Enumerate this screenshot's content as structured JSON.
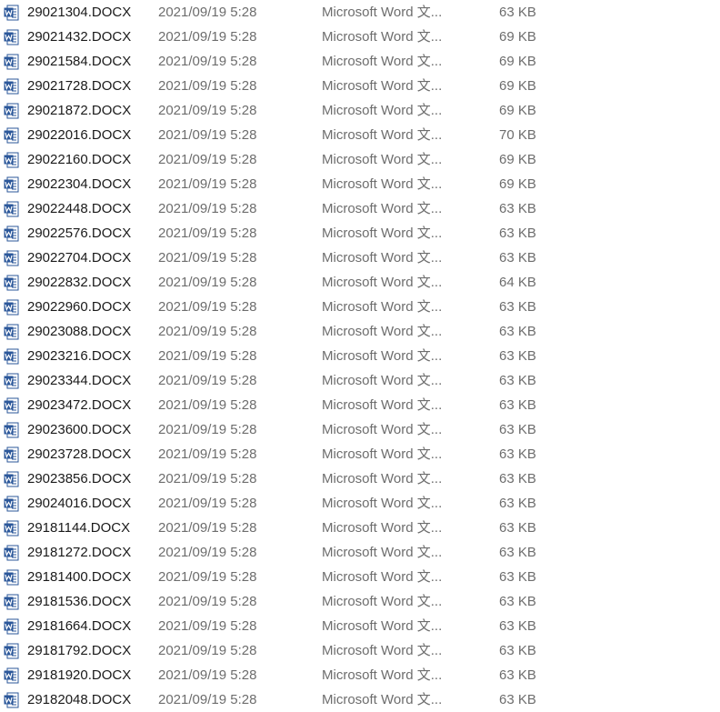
{
  "file_list": {
    "rows": [
      {
        "name": "29021304.DOCX",
        "modified": "2021/09/19 5:28",
        "type": "Microsoft Word 文...",
        "size": "63 KB"
      },
      {
        "name": "29021432.DOCX",
        "modified": "2021/09/19 5:28",
        "type": "Microsoft Word 文...",
        "size": "69 KB"
      },
      {
        "name": "29021584.DOCX",
        "modified": "2021/09/19 5:28",
        "type": "Microsoft Word 文...",
        "size": "69 KB"
      },
      {
        "name": "29021728.DOCX",
        "modified": "2021/09/19 5:28",
        "type": "Microsoft Word 文...",
        "size": "69 KB"
      },
      {
        "name": "29021872.DOCX",
        "modified": "2021/09/19 5:28",
        "type": "Microsoft Word 文...",
        "size": "69 KB"
      },
      {
        "name": "29022016.DOCX",
        "modified": "2021/09/19 5:28",
        "type": "Microsoft Word 文...",
        "size": "70 KB"
      },
      {
        "name": "29022160.DOCX",
        "modified": "2021/09/19 5:28",
        "type": "Microsoft Word 文...",
        "size": "69 KB"
      },
      {
        "name": "29022304.DOCX",
        "modified": "2021/09/19 5:28",
        "type": "Microsoft Word 文...",
        "size": "69 KB"
      },
      {
        "name": "29022448.DOCX",
        "modified": "2021/09/19 5:28",
        "type": "Microsoft Word 文...",
        "size": "63 KB"
      },
      {
        "name": "29022576.DOCX",
        "modified": "2021/09/19 5:28",
        "type": "Microsoft Word 文...",
        "size": "63 KB"
      },
      {
        "name": "29022704.DOCX",
        "modified": "2021/09/19 5:28",
        "type": "Microsoft Word 文...",
        "size": "63 KB"
      },
      {
        "name": "29022832.DOCX",
        "modified": "2021/09/19 5:28",
        "type": "Microsoft Word 文...",
        "size": "64 KB"
      },
      {
        "name": "29022960.DOCX",
        "modified": "2021/09/19 5:28",
        "type": "Microsoft Word 文...",
        "size": "63 KB"
      },
      {
        "name": "29023088.DOCX",
        "modified": "2021/09/19 5:28",
        "type": "Microsoft Word 文...",
        "size": "63 KB"
      },
      {
        "name": "29023216.DOCX",
        "modified": "2021/09/19 5:28",
        "type": "Microsoft Word 文...",
        "size": "63 KB"
      },
      {
        "name": "29023344.DOCX",
        "modified": "2021/09/19 5:28",
        "type": "Microsoft Word 文...",
        "size": "63 KB"
      },
      {
        "name": "29023472.DOCX",
        "modified": "2021/09/19 5:28",
        "type": "Microsoft Word 文...",
        "size": "63 KB"
      },
      {
        "name": "29023600.DOCX",
        "modified": "2021/09/19 5:28",
        "type": "Microsoft Word 文...",
        "size": "63 KB"
      },
      {
        "name": "29023728.DOCX",
        "modified": "2021/09/19 5:28",
        "type": "Microsoft Word 文...",
        "size": "63 KB"
      },
      {
        "name": "29023856.DOCX",
        "modified": "2021/09/19 5:28",
        "type": "Microsoft Word 文...",
        "size": "63 KB"
      },
      {
        "name": "29024016.DOCX",
        "modified": "2021/09/19 5:28",
        "type": "Microsoft Word 文...",
        "size": "63 KB"
      },
      {
        "name": "29181144.DOCX",
        "modified": "2021/09/19 5:28",
        "type": "Microsoft Word 文...",
        "size": "63 KB"
      },
      {
        "name": "29181272.DOCX",
        "modified": "2021/09/19 5:28",
        "type": "Microsoft Word 文...",
        "size": "63 KB"
      },
      {
        "name": "29181400.DOCX",
        "modified": "2021/09/19 5:28",
        "type": "Microsoft Word 文...",
        "size": "63 KB"
      },
      {
        "name": "29181536.DOCX",
        "modified": "2021/09/19 5:28",
        "type": "Microsoft Word 文...",
        "size": "63 KB"
      },
      {
        "name": "29181664.DOCX",
        "modified": "2021/09/19 5:28",
        "type": "Microsoft Word 文...",
        "size": "63 KB"
      },
      {
        "name": "29181792.DOCX",
        "modified": "2021/09/19 5:28",
        "type": "Microsoft Word 文...",
        "size": "63 KB"
      },
      {
        "name": "29181920.DOCX",
        "modified": "2021/09/19 5:28",
        "type": "Microsoft Word 文...",
        "size": "63 KB"
      },
      {
        "name": "29182048.DOCX",
        "modified": "2021/09/19 5:28",
        "type": "Microsoft Word 文...",
        "size": "63 KB"
      }
    ]
  },
  "icon": {
    "name": "word-document-icon",
    "accent": "#2b579a"
  },
  "colors": {
    "name_text": "#1a1a1a",
    "detail_text": "#6d6d6d",
    "background": "#ffffff"
  }
}
